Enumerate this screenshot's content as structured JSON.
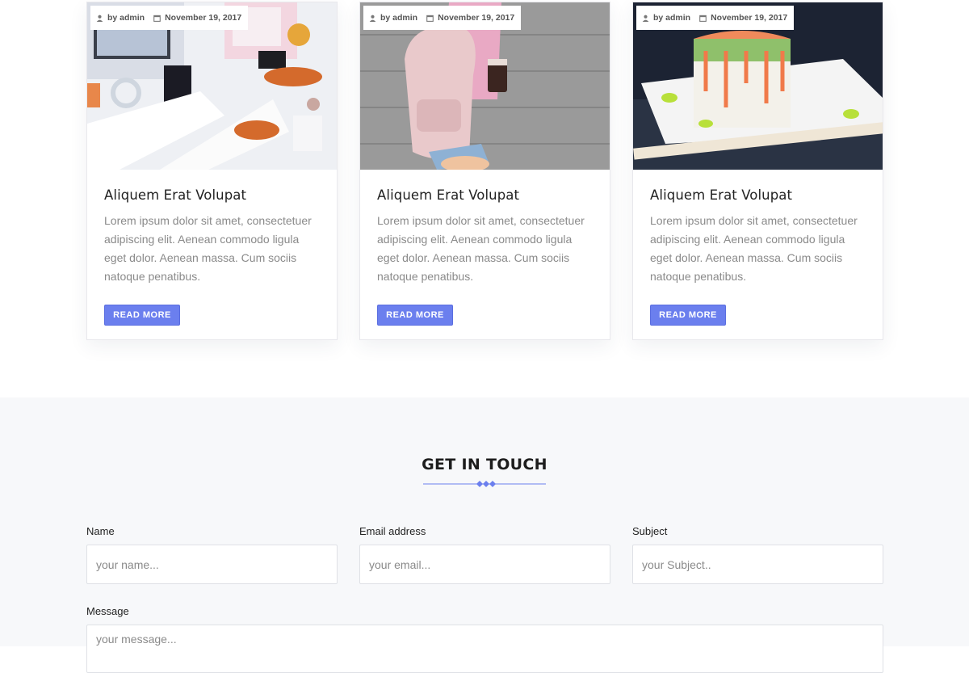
{
  "posts": [
    {
      "author": "by admin",
      "date": "November 19, 2017",
      "title": "Aliquem Erat Volupat",
      "excerpt": "Lorem ipsum dolor sit amet, consectetuer adipiscing elit. Aenean commodo ligula eget dolor. Aenean massa. Cum sociis natoque penatibus.",
      "button": "READ MORE"
    },
    {
      "author": "by admin",
      "date": "November 19, 2017",
      "title": "Aliquem Erat Volupat",
      "excerpt": "Lorem ipsum dolor sit amet, consectetuer adipiscing elit. Aenean commodo ligula eget dolor. Aenean massa. Cum sociis natoque penatibus.",
      "button": "READ MORE"
    },
    {
      "author": "by admin",
      "date": "November 19, 2017",
      "title": "Aliquem Erat Volupat",
      "excerpt": "Lorem ipsum dolor sit amet, consectetuer adipiscing elit. Aenean commodo ligula eget dolor. Aenean massa. Cum sociis natoque penatibus.",
      "button": "READ MORE"
    }
  ],
  "contact": {
    "title": "GET IN TOUCH",
    "name_label": "Name",
    "name_placeholder": "your name...",
    "email_label": "Email address",
    "email_placeholder": "your email...",
    "subject_label": "Subject",
    "subject_placeholder": "your Subject..",
    "message_label": "Message",
    "message_placeholder": "your message..."
  },
  "colors": {
    "accent": "#6b7fee",
    "section_bg": "#f7f8fa"
  },
  "icons": {
    "author": "user-icon",
    "date": "calendar-icon",
    "divider": "diamond-divider"
  }
}
